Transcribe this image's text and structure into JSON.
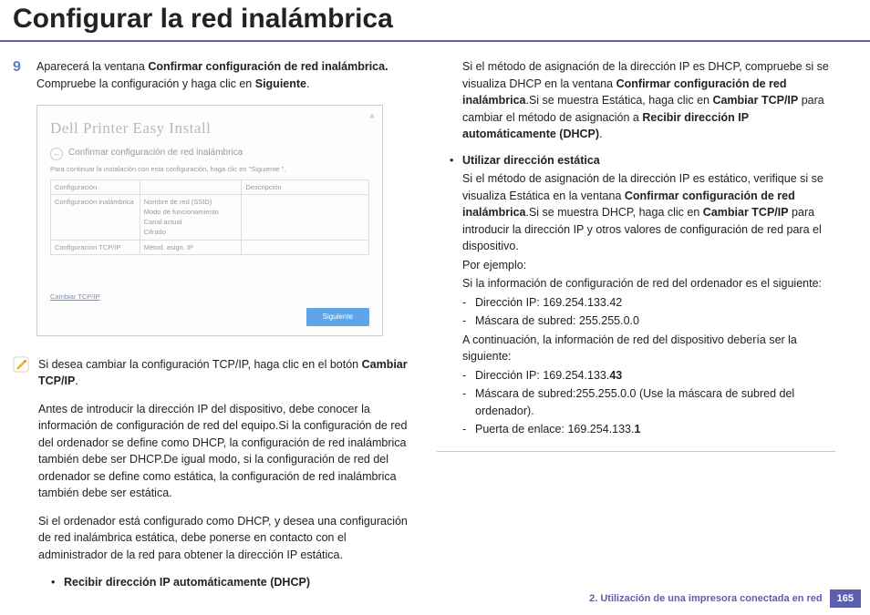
{
  "title": "Configurar la red inalámbrica",
  "step_number": "9",
  "step_text_pre": "Aparecerá la ventana ",
  "step_bold_1": "Confirmar configuración de red inalámbrica.",
  "step_text_mid": " Compruebe la configuración y haga clic en ",
  "step_bold_2": "Siguiente",
  "shot": {
    "brand": "Dell Printer Easy Install",
    "subtitle": "Confirmar configuración de red inalámbrica",
    "instr": "Para continuar la instalación con esta configuración, haga clic en \"Siguiente \".",
    "h1": "Configuración",
    "h2": "",
    "h3": "Descripción",
    "r1c1": "Configuración inalámbrica",
    "r1c2a": "Nombre de red (SSID)",
    "r1c2b": "Modo de funcionamiento",
    "r1c2c": "Canal actual",
    "r1c2d": "Cifrado",
    "r2c1": "Configuracion TCP/IP",
    "r2c2": "Métod. asign. IP",
    "link": "Cambiar TCP/IP",
    "btn": "Siguiente"
  },
  "note_p1_a": "Si desea cambiar la configuración TCP/IP, haga clic en el botón ",
  "note_p1_b": "Cambiar TCP/IP",
  "note_p2": "Antes de introducir la dirección IP del dispositivo, debe conocer la información de configuración de red del equipo.Si la configuración de red del ordenador se define como DHCP, la configuración de red inalámbrica también debe ser DHCP.De igual modo, si la configuración de red del ordenador se define como estática, la configuración de red inalámbrica también debe ser estática.",
  "note_p3": "Si el ordenador está configurado como DHCP, y desea una configuración de red inalámbrica estática, debe ponerse en contacto con el administrador de la red para obtener la dirección IP estática.",
  "note_bullet1": "Recibir dirección IP automáticamente (DHCP)",
  "c2": {
    "p1_a": "Si el método de asignación de la dirección IP es DHCP, compruebe si se visualiza DHCP en la ventana ",
    "p1_b1": "Confirmar configuración de red inalámbrica",
    "p1_c": ".Si se muestra Estática, haga clic en ",
    "p1_b2": "Cambiar TCP/IP",
    "p1_d": " para cambiar el método de asignación a ",
    "p1_b3": "Recibir dirección IP automáticamente (DHCP)",
    "bullet2": "Utilizar dirección estática",
    "p2_a": "Si el método de asignación de la dirección IP es estático, verifique si se visualiza Estática en la ventana ",
    "p2_b1": "Confirmar configuración de red inalámbrica",
    "p2_c": ".Si se muestra DHCP, haga clic en ",
    "p2_b2": "Cambiar TCP/IP",
    "p2_d": " para introducir la dirección IP y otros valores de configuración de red para el dispositivo.",
    "p3": "Por ejemplo:",
    "p4": "Si la información de configuración de red del ordenador es el siguiente:",
    "d1": "Dirección IP: 169.254.133.42",
    "d2": "Máscara de subred: 255.255.0.0",
    "p5": "A continuación, la información de red del dispositivo debería ser la siguiente:",
    "d3a": "Dirección IP: 169.254.133.",
    "d3b": "43",
    "d4": "Máscara de subred:255.255.0.0 (Use la máscara de subred del ordenador).",
    "d5a": "Puerta de enlace: 169.254.133.",
    "d5b": "1"
  },
  "footer_chap": "2.  Utilización de una impresora conectada en red",
  "footer_page": "165"
}
